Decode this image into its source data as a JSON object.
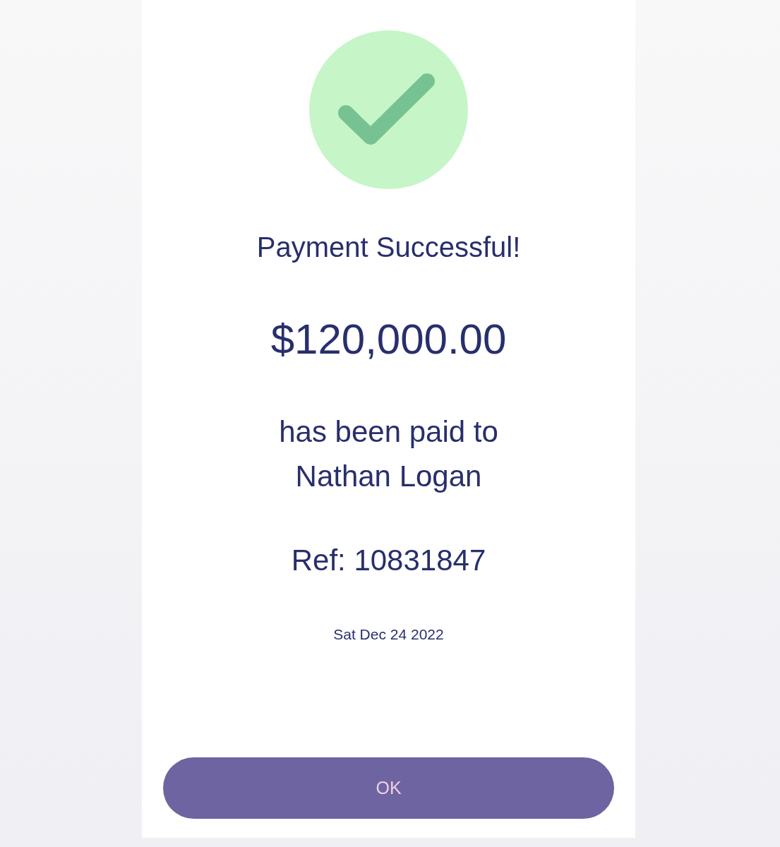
{
  "status": {
    "kind": "success",
    "title": "Payment Successful!"
  },
  "amount": "$120,000.00",
  "recipient": "has been paid to\nNathan Logan",
  "reference": "Ref: 10831847",
  "date": "Sat Dec 24 2022",
  "button": {
    "label": "OK"
  }
}
